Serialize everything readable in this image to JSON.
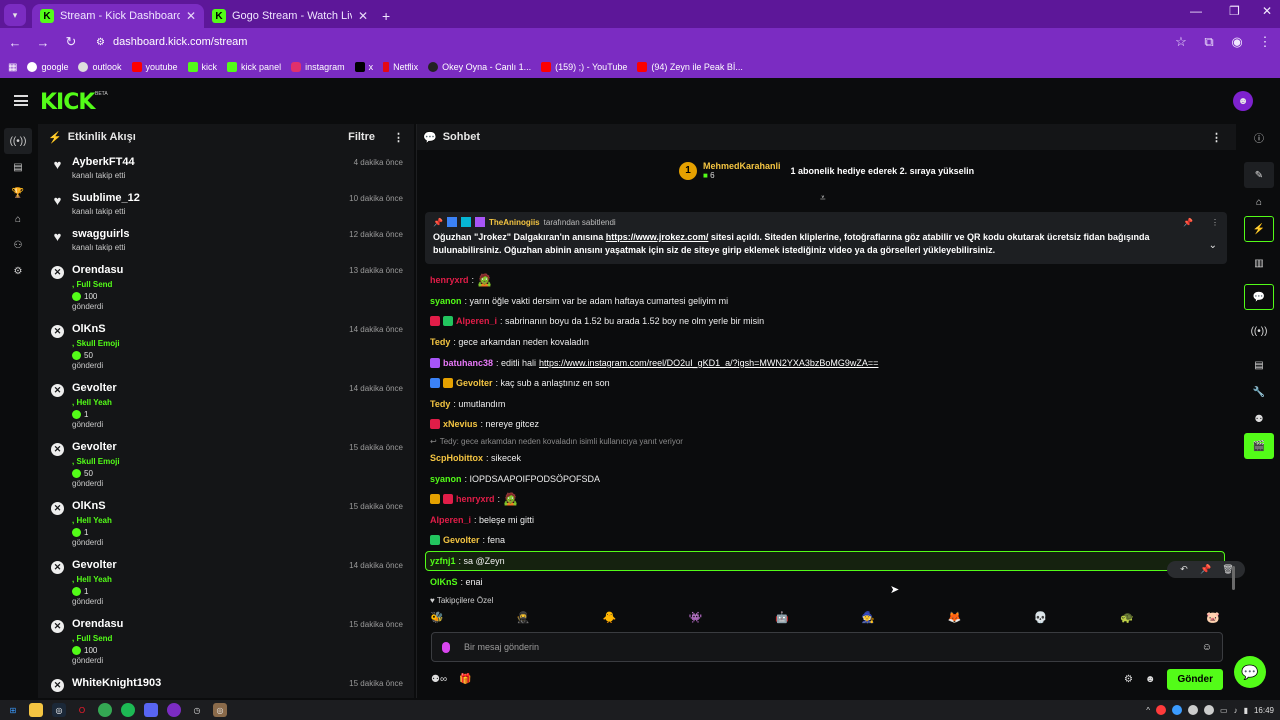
{
  "browser": {
    "tabs": [
      {
        "title": "Stream - Kick Dashboard",
        "active": true
      },
      {
        "title": "Gogo Stream - Watch Live on K",
        "active": false
      }
    ],
    "url": "dashboard.kick.com/stream",
    "bookmarks": [
      "google",
      "outlook",
      "youtube",
      "kick",
      "kick panel",
      "instagram",
      "x",
      "Netflix",
      "Okey Oyna - Canlı 1...",
      "(159) ;) - YouTube",
      "(94) Zeyn ile Peak Bİ..."
    ]
  },
  "app": {
    "logo": "KICK",
    "beta": "BETA",
    "accent": "#53fc18"
  },
  "activity": {
    "title": "Etkinlik Akışı",
    "filter": "Filtre",
    "items": [
      {
        "type": "follow",
        "user": "AyberkFT44",
        "text": "kanalı takip etti",
        "time": "4 dakika önce"
      },
      {
        "type": "follow",
        "user": "Suublime_12",
        "text": "kanalı takip etti",
        "time": "10 dakika önce"
      },
      {
        "type": "follow",
        "user": "swagguirls",
        "text": "kanalı takip etti",
        "time": "12 dakika önce"
      },
      {
        "type": "gift",
        "user": "Orendasu",
        "pack": ", Full Send",
        "count": "100",
        "text": "gönderdi",
        "time": "13 dakika önce"
      },
      {
        "type": "gift",
        "user": "OlKnS",
        "pack": ", Skull Emoji",
        "count": "50",
        "text": "gönderdi",
        "time": "14 dakika önce"
      },
      {
        "type": "gift",
        "user": "Gevolter",
        "pack": ", Hell Yeah",
        "count": "1",
        "text": "gönderdi",
        "time": "14 dakika önce"
      },
      {
        "type": "gift",
        "user": "Gevolter",
        "pack": ", Skull Emoji",
        "count": "50",
        "text": "gönderdi",
        "time": "15 dakika önce"
      },
      {
        "type": "gift",
        "user": "OlKnS",
        "pack": ", Hell Yeah",
        "count": "1",
        "text": "gönderdi",
        "time": "15 dakika önce"
      },
      {
        "type": "gift",
        "user": "Gevolter",
        "pack": ", Hell Yeah",
        "count": "1",
        "text": "gönderdi",
        "time": "14 dakika önce"
      },
      {
        "type": "gift",
        "user": "Orendasu",
        "pack": ", Full Send",
        "count": "100",
        "text": "gönderdi",
        "time": "15 dakika önce"
      },
      {
        "type": "gift",
        "user": "WhiteKnight1903",
        "pack": "",
        "count": "",
        "text": "",
        "time": "15 dakika önce"
      }
    ]
  },
  "chat": {
    "title": "Sohbet",
    "gifter": {
      "rank": "1",
      "name": "MehmedKarahanli",
      "count": "6",
      "message": "1 abonelik hediye ederek 2. sıraya yükselin"
    },
    "pinned": {
      "by": "TheAninogiis",
      "by_suffix": "tarafından sabitlendi",
      "text_before": "Oğuzhan \"Jrokez\" Dalgakıran'ın anısına ",
      "link": "https://www.jrokez.com/",
      "text_after": " sitesi açıldı. Siteden kliplerine, fotoğraflarına göz atabilir ve QR kodu okutarak ücretsiz fidan bağışında bulunabilirsiniz. Oğuzhan abinin anısını yaşatmak için siz de siteye girip eklemek istediğiniz video ya da görselleri yükleyebilirsiniz."
    },
    "messages": [
      {
        "user": "henryxrd",
        "color": "#e11d48",
        "text": ":",
        "emote": true
      },
      {
        "user": "syanon",
        "color": "#53fc18",
        "text": ": yarın öğle vakti dersim var be adam haftaya cumartesi geliyim mi"
      },
      {
        "user": "Alperen_i",
        "color": "#e11d48",
        "text": ": sabrinanın boyu da 1.52 bu arada 1.52 boy ne olm yerle bir misin"
      },
      {
        "user": "Tedy",
        "color": "#f4c542",
        "text": ": gece arkamdan neden kovaladın"
      },
      {
        "user": "batuhanc38",
        "color": "#e879f9",
        "text": ": editli hali ",
        "link": "https://www.instagram.com/reel/DO2uI_gKD1_a/?igsh=MWN2YXA3bzBoMG9wZA=="
      },
      {
        "user": "Gevolter",
        "color": "#f4c542",
        "text": ": kaç sub a anlaştınız en son"
      },
      {
        "user": "Tedy",
        "color": "#f4c542",
        "text": ": umutlandım"
      },
      {
        "user": "xNevius",
        "color": "#f4c542",
        "text": ": nereye gitcez"
      },
      {
        "reply": "Tedy: gece arkamdan neden kovaladın isimli kullanıcıya yanıt veriyor"
      },
      {
        "user": "ScpHobittox",
        "color": "#f4c542",
        "text": ": sikecek"
      },
      {
        "user": "syanon",
        "color": "#53fc18",
        "text": ": IOPDSAAPOIFPODSÖPOFSDA"
      },
      {
        "user": "henryxrd",
        "color": "#e11d48",
        "text": ":",
        "emote": true
      },
      {
        "user": "Alperen_i",
        "color": "#e11d48",
        "text": ": beleşe mi gitti"
      },
      {
        "user": "Gevolter",
        "color": "#f4c542",
        "text": ": fena"
      },
      {
        "user": "yzfnj1",
        "color": "#53fc18",
        "text": ": sa @Zeyn",
        "highlight": true
      },
      {
        "user": "OlKnS",
        "color": "#53fc18",
        "text": ": enai"
      }
    ],
    "emote_label": "Takipçilere Özel",
    "input_placeholder": "Bir mesaj gönderin",
    "send_label": "Gönder"
  },
  "taskbar": {
    "time": "16:49"
  }
}
